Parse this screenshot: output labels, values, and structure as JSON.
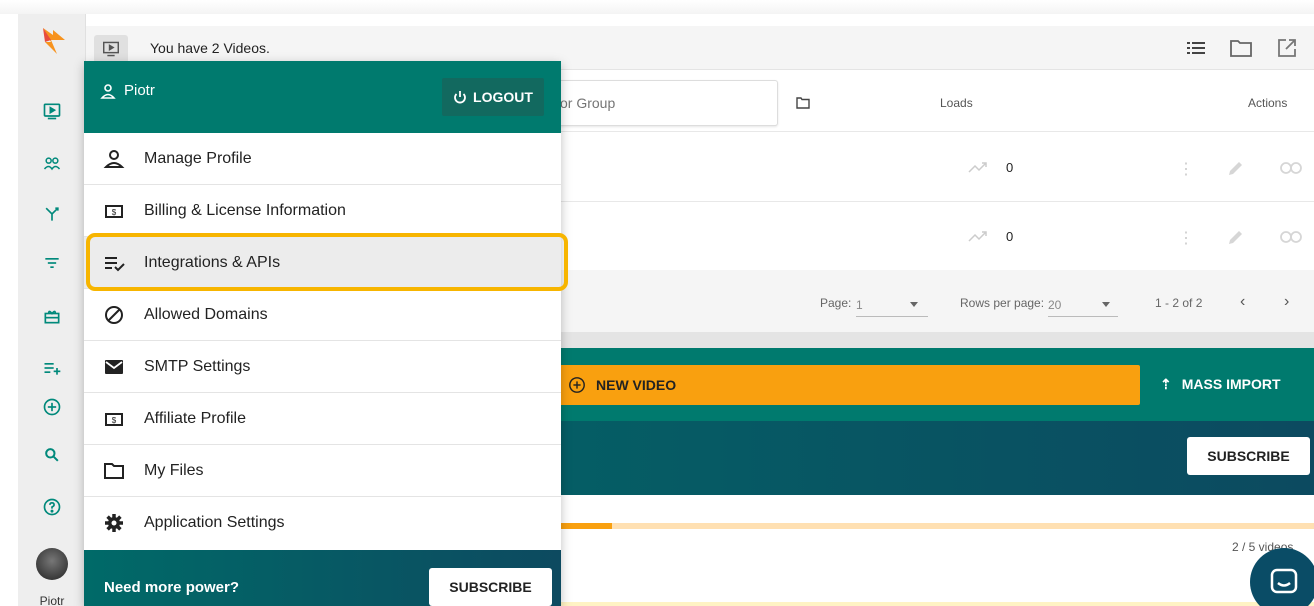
{
  "topbar": {
    "title": "You have 2 Videos."
  },
  "sidebar": {
    "user_name": "Piotr"
  },
  "table": {
    "search_placeholder": "or Group",
    "columns": {
      "loads": "Loads",
      "actions": "Actions"
    },
    "rows": [
      {
        "loads": "0"
      },
      {
        "loads": "0"
      }
    ],
    "pager": {
      "page_label": "Page:",
      "page_value": "1",
      "rows_label": "Rows per page:",
      "rows_value": "20",
      "range": "1 - 2 of 2"
    }
  },
  "actions": {
    "new_video": "NEW VIDEO",
    "mass_import": "MASS IMPORT"
  },
  "banner": {
    "subscribe": "SUBSCRIBE"
  },
  "usage": {
    "label": "2 / 5 videos",
    "fraction": 0.4
  },
  "menu": {
    "user": "Piotr",
    "logout": "LOGOUT",
    "items": [
      {
        "label": "Manage Profile",
        "icon": "person-icon"
      },
      {
        "label": "Billing & License Information",
        "icon": "billing-icon"
      },
      {
        "label": "Integrations & APIs",
        "icon": "playlist-check-icon"
      },
      {
        "label": "Allowed Domains",
        "icon": "block-icon"
      },
      {
        "label": "SMTP Settings",
        "icon": "mail-icon"
      },
      {
        "label": "Affiliate Profile",
        "icon": "billing-icon"
      },
      {
        "label": "My Files",
        "icon": "folder-icon"
      },
      {
        "label": "Application Settings",
        "icon": "gear-icon"
      }
    ],
    "footer_text": "Need more power?",
    "footer_button": "SUBSCRIBE"
  },
  "colors": {
    "teal": "#007a6e",
    "orange": "#f9a00f",
    "highlight": "#f7b500"
  }
}
